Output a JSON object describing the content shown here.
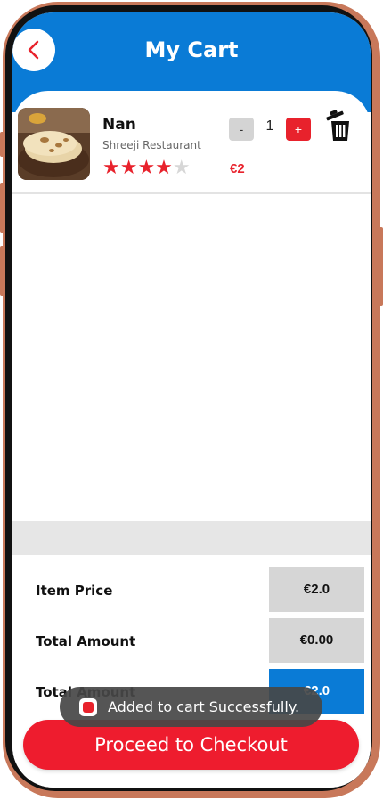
{
  "header": {
    "title": "My Cart",
    "back_icon": "chevron-left-icon"
  },
  "cart_items": [
    {
      "name": "Nan",
      "restaurant": "Shreeji Restaurant",
      "rating": 4,
      "rating_max": 5,
      "stars_on": "★★★★",
      "stars_off": "★",
      "qty_minus": "-",
      "quantity": "1",
      "qty_plus": "+",
      "price": "€2",
      "image": "naan-bread-photo",
      "delete_icon": "trash-icon"
    }
  ],
  "summary": {
    "item_price_label": "Item Price",
    "item_price_value": "€2.0",
    "total_label_1": "Total Amount",
    "total_value_1": "€0.00",
    "total_label_2": "Total Amount",
    "total_value_2": "€2.0"
  },
  "toast": {
    "text": "Added to cart Successfully."
  },
  "checkout_label": "Proceed to Checkout",
  "colors": {
    "primary_blue": "#0a7bd6",
    "accent_red": "#e8222c",
    "frame_copper": "#c8785a"
  }
}
